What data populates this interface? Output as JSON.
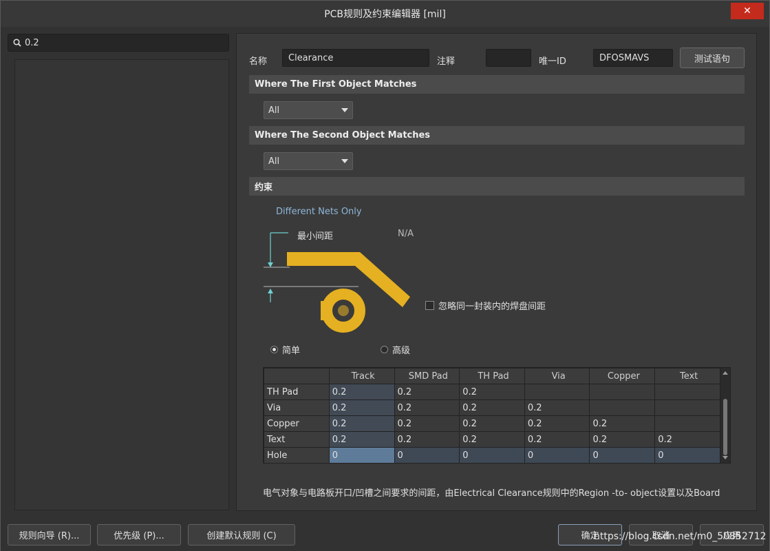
{
  "window": {
    "title": "PCB规则及约束编辑器 [mil]",
    "close": "✕"
  },
  "search": {
    "value": "0.2"
  },
  "header": {
    "name_label": "名称",
    "name_value": "Clearance",
    "comment_label": "注释",
    "comment_value": "",
    "uid_label": "唯一ID",
    "uid_value": "DFOSMAVS",
    "test_button": "测试语句"
  },
  "first_match": {
    "title": "Where The First Object Matches",
    "selected": "All"
  },
  "second_match": {
    "title": "Where The Second Object Matches",
    "selected": "All"
  },
  "constraint": {
    "title": "约束",
    "net_scope": "Different Nets Only",
    "min_clearance_label": "最小间距",
    "min_clearance_value": "N/A",
    "ignore_pads_label": "忽略同一封装内的焊盘间距",
    "ignore_pads_checked": false,
    "mode_simple": "简单",
    "mode_advanced": "高级",
    "mode_selected": "simple"
  },
  "grid": {
    "columns": [
      "",
      "Track",
      "SMD Pad",
      "TH Pad",
      "Via",
      "Copper",
      "Text"
    ],
    "rows": [
      {
        "label": "TH Pad",
        "cells": [
          "0.2",
          "0.2",
          "0.2",
          "",
          "",
          ""
        ]
      },
      {
        "label": "Via",
        "cells": [
          "0.2",
          "0.2",
          "0.2",
          "0.2",
          "",
          ""
        ]
      },
      {
        "label": "Copper",
        "cells": [
          "0.2",
          "0.2",
          "0.2",
          "0.2",
          "0.2",
          ""
        ]
      },
      {
        "label": "Text",
        "cells": [
          "0.2",
          "0.2",
          "0.2",
          "0.2",
          "0.2",
          "0.2"
        ]
      },
      {
        "label": "Hole",
        "cells": [
          "0",
          "0",
          "0",
          "0",
          "0",
          "0"
        ]
      }
    ]
  },
  "description": "电气对象与电路板开口/凹槽之间要求的间距，由Electrical Clearance规则中的Region -to- object设置以及Board",
  "footer": {
    "wizard": "规则向导 (R)...",
    "priority": "优先级 (P)...",
    "create_default": "创建默认规则 (C)",
    "ok": "确定",
    "cancel": "取消",
    "apply": "应用"
  },
  "watermark": "https://blog.csdn.net/m0_50852712",
  "colors": {
    "pad_copper": "#e5b021",
    "dimension_line": "#6fcfcf"
  }
}
